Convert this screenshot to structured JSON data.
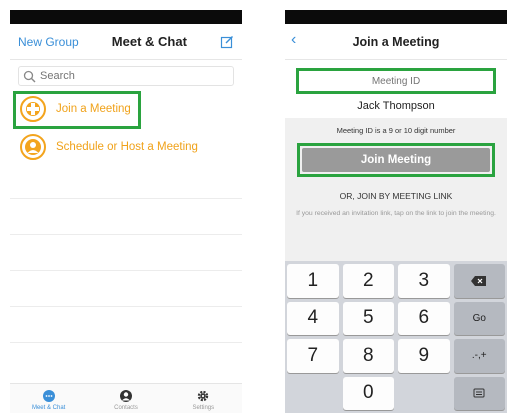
{
  "left": {
    "header": {
      "new_group": "New Group",
      "title": "Meet & Chat"
    },
    "search": {
      "placeholder": "Search"
    },
    "items": [
      {
        "label": "Join a Meeting"
      },
      {
        "label": "Schedule or Host a Meeting"
      }
    ],
    "tabs": [
      {
        "label": "Meet & Chat"
      },
      {
        "label": "Contacts"
      },
      {
        "label": "Settings"
      }
    ]
  },
  "right": {
    "header": {
      "title": "Join a Meeting"
    },
    "meeting_id": {
      "placeholder": "Meeting ID"
    },
    "name": "Jack Thompson",
    "hint": "Meeting ID is a 9 or 10 digit number",
    "join_label": "Join Meeting",
    "or_label": "OR, JOIN BY MEETING LINK",
    "info": "If you received an invitation link, tap on the link to join the meeting.",
    "keys": {
      "k1": "1",
      "k2": "2",
      "k3": "3",
      "k4": "4",
      "k5": "5",
      "k6": "6",
      "go": "Go",
      "k7": "7",
      "k8": "8",
      "k9": "9",
      "sym": ".-,+",
      "k0": "0"
    }
  },
  "colors": {
    "accent": "#3a8fd8",
    "highlight": "#2aa33f",
    "orange": "#f3a41d"
  }
}
